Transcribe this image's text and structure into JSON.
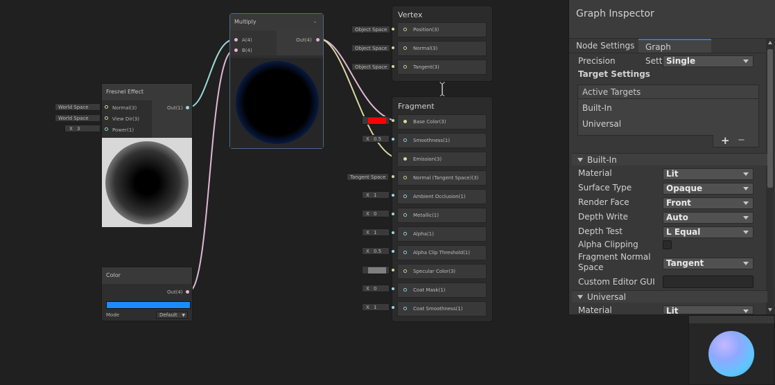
{
  "colors": {
    "fresnel_preview": "#ffffff",
    "base_color": "#ff0000",
    "emission_color": "#1a8cff",
    "specular_color": "#7f7f7f",
    "accent": "#3a79bb"
  },
  "multiply_node": {
    "title": "Multiply",
    "inputs": [
      "A(4)",
      "B(4)"
    ],
    "output": "Out(4)",
    "expand_icon": "chevron-up-icon"
  },
  "fresnel_node": {
    "title": "Fresnel Effect",
    "inputs": [
      "Normal(3)",
      "View Dir(3)",
      "Power(1)"
    ],
    "output": "Out(1)",
    "chips": [
      "World Space",
      "World Space"
    ],
    "power_label": "X",
    "power_value": "3"
  },
  "color_node": {
    "title": "Color",
    "output": "Out(4)",
    "mode_label": "Mode",
    "mode_value": "Default"
  },
  "vertex_block": {
    "title": "Vertex",
    "rows": [
      {
        "chip": "Object Space",
        "label": "Position(3)"
      },
      {
        "chip": "Object Space",
        "label": "Normal(3)"
      },
      {
        "chip": "Object Space",
        "label": "Tangent(3)"
      }
    ]
  },
  "fragment_block": {
    "title": "Fragment",
    "rows": [
      {
        "label": "Base Color(3)"
      },
      {
        "x": "X",
        "value": "0.5",
        "label": "Smoothness(1)"
      },
      {
        "label": "Emission(3)"
      },
      {
        "chip": "Tangent Space",
        "label": "Normal (Tangent Space)(3)"
      },
      {
        "x": "X",
        "value": "1",
        "label": "Ambient Occlusion(1)"
      },
      {
        "x": "X",
        "value": "0",
        "label": "Metallic(1)"
      },
      {
        "x": "X",
        "value": "1",
        "label": "Alpha(1)"
      },
      {
        "x": "X",
        "value": "0.5",
        "label": "Alpha Clip Threshold(1)"
      },
      {
        "label": "Specular Color(3)"
      },
      {
        "x": "X",
        "value": "0",
        "label": "Coat Mask(1)"
      },
      {
        "x": "X",
        "value": "1",
        "label": "Coat Smoothness(1)"
      }
    ]
  },
  "inspector": {
    "title": "Graph Inspector",
    "tabs": [
      "Node Settings",
      "Graph Settings"
    ],
    "precision_label": "Precision",
    "precision_value": "Single",
    "target_settings": "Target Settings",
    "active_targets": "Active Targets",
    "targets": [
      "Built-In",
      "Universal"
    ],
    "add_symbol": "+",
    "remove_symbol": "−",
    "builtin_section": "Built-In",
    "fields": [
      {
        "label": "Material",
        "value": "Lit"
      },
      {
        "label": "Surface Type",
        "value": "Opaque"
      },
      {
        "label": "Render Face",
        "value": "Front"
      },
      {
        "label": "Depth Write",
        "value": "Auto"
      },
      {
        "label": "Depth Test",
        "value": "L Equal"
      }
    ],
    "alpha_clipping_label": "Alpha Clipping",
    "fragment_normal_label_1": "Fragment Normal",
    "fragment_normal_label_2": "Space",
    "fragment_normal_value": "Tangent",
    "custom_editor_label": "Custom Editor GUI",
    "universal_section": "Universal",
    "universal_material_label": "Material",
    "universal_material_value": "Lit"
  }
}
